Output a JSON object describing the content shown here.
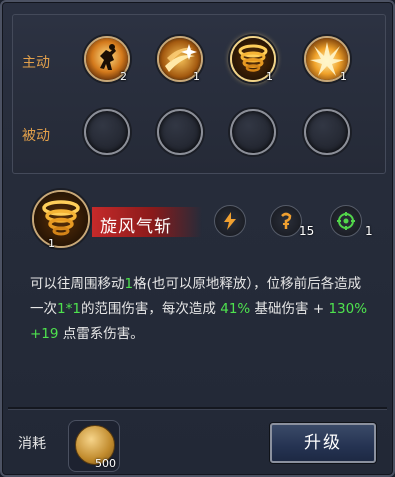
{
  "labels": {
    "active": "主动",
    "passive": "被动"
  },
  "active_skills": [
    {
      "icon": "leaping-figure-icon",
      "level": "2"
    },
    {
      "icon": "sparkle-slash-icon",
      "level": "1"
    },
    {
      "icon": "whirlwind-icon",
      "level": "1",
      "selected": true
    },
    {
      "icon": "lightning-burst-icon",
      "level": "1"
    }
  ],
  "selected_skill": {
    "name": "旋风气斩",
    "level": "1",
    "attributes": [
      {
        "icon": "lightning-icon",
        "value": ""
      },
      {
        "icon": "hook-rune-icon",
        "value": "15"
      },
      {
        "icon": "target-icon",
        "value": "1"
      }
    ],
    "description": [
      {
        "t": "可以往周围移动",
        "c": "w"
      },
      {
        "t": "1",
        "c": "g"
      },
      {
        "t": "格(也可以原地释放），位移前后各造成一次",
        "c": "w"
      },
      {
        "t": "1*1",
        "c": "g"
      },
      {
        "t": "的范围伤害，每次造成 ",
        "c": "w"
      },
      {
        "t": "41%",
        "c": "g"
      },
      {
        "t": " 基础伤害 + ",
        "c": "w"
      },
      {
        "t": "130%+19",
        "c": "g"
      },
      {
        "t": " 点雷系伤害。",
        "c": "w"
      }
    ]
  },
  "cost": {
    "label": "消耗",
    "amount": "500",
    "icon": "gold-coin-icon"
  },
  "upgrade_label": "升级",
  "colors": {
    "accent_orange": "#e2a04b",
    "highlight_green": "#4ee34e",
    "name_bar_red": "#c52a2a"
  }
}
